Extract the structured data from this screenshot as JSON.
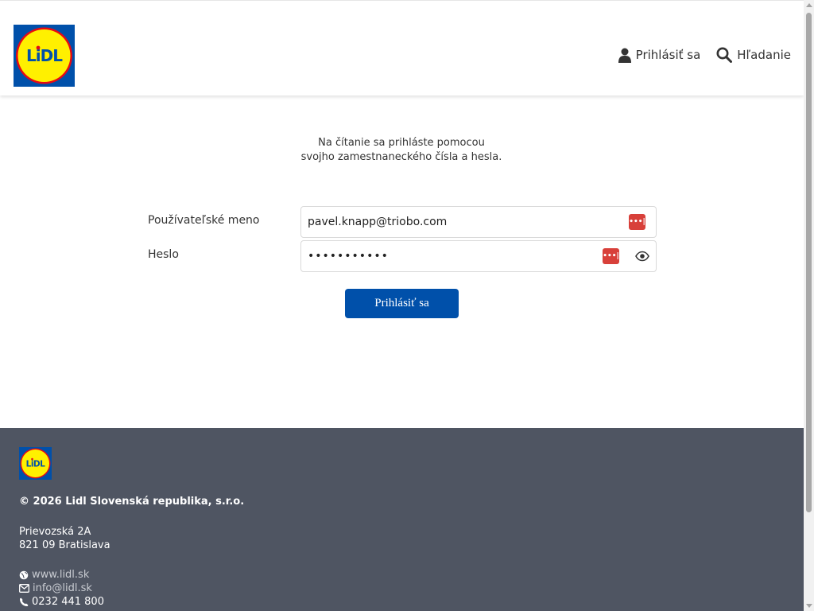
{
  "header": {
    "logo": "lidl-logo",
    "nav": {
      "login_label": "Prihlásiť sa",
      "search_label": "Hľadanie"
    }
  },
  "main": {
    "intro_line1": "Na čítanie sa prihláste pomocou",
    "intro_line2": "svojho zamestnaneckého čísla a hesla.",
    "username_label": "Používateľské meno",
    "username_value": "pavel.knapp@triobo.com",
    "password_label": "Heslo",
    "password_value": "xxxxxxxxxxx",
    "submit_label": "Prihlásiť sa"
  },
  "footer": {
    "copyright": "© 2026 Lidl Slovenská republika, s.r.o.",
    "address_line1": "Prievozská 2A",
    "address_line2": "821 09 Bratislava",
    "website": "www.lidl.sk",
    "email": "info@lidl.sk",
    "phone": "0232 441 800"
  },
  "colors": {
    "brand_blue": "#0050aa",
    "brand_yellow": "#fff000",
    "brand_red": "#e60a14",
    "footer_bg": "#4f5562",
    "password_manager_red": "#d8403a"
  }
}
